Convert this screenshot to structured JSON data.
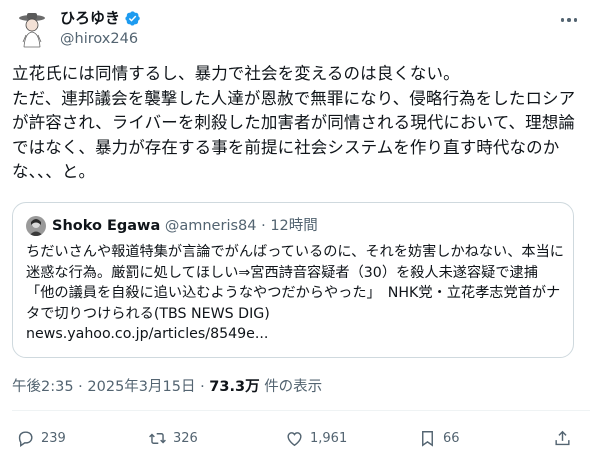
{
  "author": {
    "name": "ひろゆき",
    "handle": "@hirox246",
    "verified_icon": "verified-badge-icon"
  },
  "tweet": {
    "text": "立花氏には同情するし、暴力で社会を変えるのは良くない。\nただ、連邦議会を襲撃した人達が恩赦で無罪になり、侵略行為をしたロシアが許容され、ライバーを刺殺した加害者が同情される現代において、理想論ではなく、暴力が存在する事を前提に社会システムを作り直す時代なのかな、、、と。"
  },
  "quote": {
    "name": "Shoko Egawa",
    "handle": "@amneris84",
    "separator": "·",
    "time": "12時間",
    "text": "ちだいさんや報道特集が言論でがんばっているのに、それを妨害しかねない、本当に迷惑な行為。厳罰に処してほしい⇒宮西詩音容疑者（30）を殺人未遂容疑で逮捕 「他の議員を自殺に追い込むようなやつだからやった」　NHK党・立花孝志党首がナタで切りつけられる(TBS NEWS DIG)\nnews.yahoo.co.jp/articles/8549e..."
  },
  "meta": {
    "time": "午後2:35",
    "dot": "·",
    "date": "2025年3月15日",
    "views": "73.3万",
    "views_label": "件の表示"
  },
  "actions": {
    "reply_count": "239",
    "retweet_count": "326",
    "like_count": "1,961",
    "bookmark_count": "66"
  },
  "colors": {
    "text": "#0f1419",
    "secondary": "#536471",
    "border": "#cfd9de",
    "verified": "#1d9bf0"
  }
}
